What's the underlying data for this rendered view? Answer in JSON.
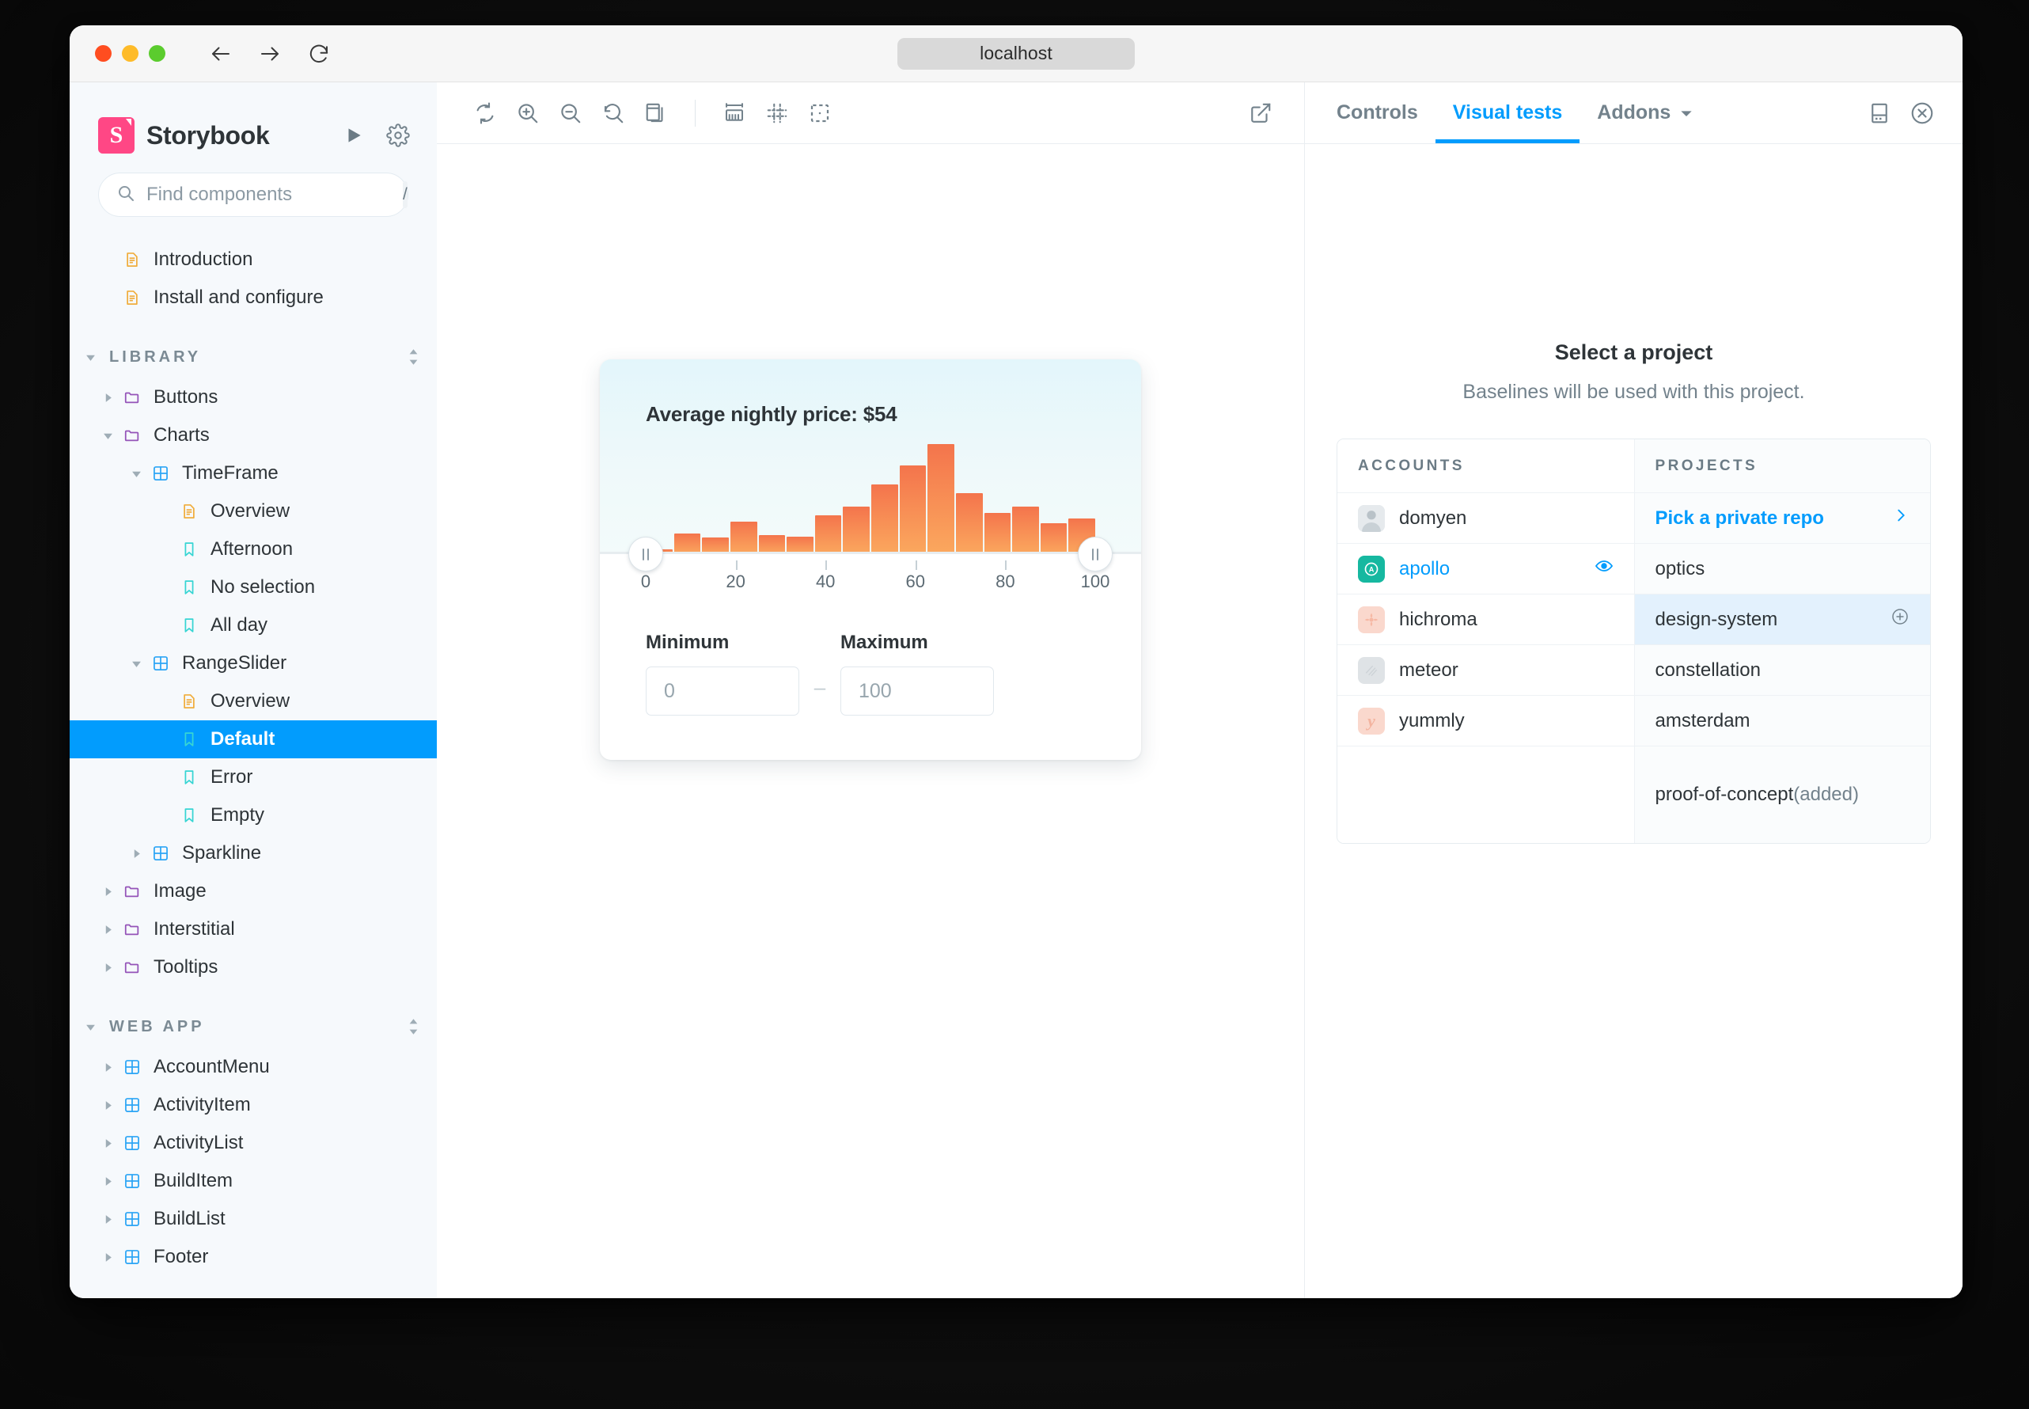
{
  "browser": {
    "url": "localhost",
    "back_icon": "arrow-left-icon",
    "forward_icon": "arrow-right-icon",
    "reload_icon": "reload-icon",
    "traffic_lights": [
      "close",
      "minimize",
      "maximize"
    ]
  },
  "sidebar": {
    "brand": "Storybook",
    "logo_letter": "S",
    "brand_color": "#ff4785",
    "play_icon": "play-icon",
    "settings_icon": "gear-icon",
    "search": {
      "placeholder": "Find components",
      "value": "",
      "shortcut": "/",
      "icon": "search-icon"
    },
    "top_items": [
      {
        "label": "Introduction",
        "icon": "document-icon"
      },
      {
        "label": "Install and configure",
        "icon": "document-icon"
      }
    ],
    "sections": [
      {
        "title": "LIBRARY",
        "items": [
          {
            "label": "Buttons",
            "icon": "folder-icon",
            "depth": 0,
            "expanded": false,
            "caret": true
          },
          {
            "label": "Charts",
            "icon": "folder-icon",
            "depth": 0,
            "expanded": true,
            "caret": true
          },
          {
            "label": "TimeFrame",
            "icon": "component-icon",
            "depth": 1,
            "expanded": true,
            "caret": true
          },
          {
            "label": "Overview",
            "icon": "document-icon",
            "depth": 2,
            "caret": false
          },
          {
            "label": "Afternoon",
            "icon": "story-icon",
            "depth": 2,
            "caret": false
          },
          {
            "label": "No selection",
            "icon": "story-icon",
            "depth": 2,
            "caret": false
          },
          {
            "label": "All day",
            "icon": "story-icon",
            "depth": 2,
            "caret": false
          },
          {
            "label": "RangeSlider",
            "icon": "component-icon",
            "depth": 1,
            "expanded": true,
            "caret": true
          },
          {
            "label": "Overview",
            "icon": "document-icon",
            "depth": 2,
            "caret": false
          },
          {
            "label": "Default",
            "icon": "story-icon",
            "depth": 2,
            "caret": false,
            "selected": true
          },
          {
            "label": "Error",
            "icon": "story-icon",
            "depth": 2,
            "caret": false
          },
          {
            "label": "Empty",
            "icon": "story-icon",
            "depth": 2,
            "caret": false
          },
          {
            "label": "Sparkline",
            "icon": "component-icon",
            "depth": 1,
            "expanded": false,
            "caret": true
          },
          {
            "label": "Image",
            "icon": "folder-icon",
            "depth": 0,
            "expanded": false,
            "caret": true
          },
          {
            "label": "Interstitial",
            "icon": "folder-icon",
            "depth": 0,
            "expanded": false,
            "caret": true
          },
          {
            "label": "Tooltips",
            "icon": "folder-icon",
            "depth": 0,
            "expanded": false,
            "caret": true
          }
        ]
      },
      {
        "title": "WEB APP",
        "items": [
          {
            "label": "AccountMenu",
            "icon": "component-icon",
            "depth": 0,
            "expanded": false,
            "caret": true
          },
          {
            "label": "ActivityItem",
            "icon": "component-icon",
            "depth": 0,
            "expanded": false,
            "caret": true
          },
          {
            "label": "ActivityList",
            "icon": "component-icon",
            "depth": 0,
            "expanded": false,
            "caret": true
          },
          {
            "label": "BuildItem",
            "icon": "component-icon",
            "depth": 0,
            "expanded": false,
            "caret": true
          },
          {
            "label": "BuildList",
            "icon": "component-icon",
            "depth": 0,
            "expanded": false,
            "caret": true
          },
          {
            "label": "Footer",
            "icon": "component-icon",
            "depth": 0,
            "expanded": false,
            "caret": true
          }
        ]
      }
    ]
  },
  "canvas_toolbar": {
    "buttons": [
      {
        "name": "remount-icon",
        "title": "Remount component"
      },
      {
        "name": "zoom-in-icon",
        "title": "Zoom in"
      },
      {
        "name": "zoom-out-icon",
        "title": "Zoom out"
      },
      {
        "name": "zoom-reset-icon",
        "title": "Reset zoom"
      },
      {
        "name": "background-icon",
        "title": "Change background"
      },
      {
        "name": "measure-icon",
        "title": "Measure"
      },
      {
        "name": "grid-icon",
        "title": "Grid"
      },
      {
        "name": "outline-icon",
        "title": "Outline"
      }
    ],
    "open_new_tab_icon": "external-link-icon"
  },
  "story": {
    "title": "Average nightly price: $54",
    "minimum_label": "Minimum",
    "maximum_label": "Maximum",
    "minimum_value": "0",
    "maximum_value": "100",
    "separator": "–",
    "handle_left_icon": "slider-handle-icon",
    "handle_right_icon": "slider-handle-icon"
  },
  "chart_data": {
    "type": "bar",
    "title": "Average nightly price: $54",
    "xlabel": "",
    "ylabel": "",
    "grid": false,
    "legend": null,
    "xlim": [
      0,
      100
    ],
    "tick_labels": [
      "0",
      "20",
      "40",
      "60",
      "80",
      "100"
    ],
    "tick_values": [
      0,
      20,
      40,
      60,
      80,
      100
    ],
    "bin_width": 5.5,
    "categories": [
      "0-6",
      "6-11",
      "11-17",
      "17-22",
      "22-28",
      "28-33",
      "33-39",
      "39-44",
      "44-50",
      "50-55",
      "55-61",
      "61-66",
      "66-72",
      "72-78",
      "78-83",
      "83-89",
      "89-94",
      "94-100"
    ],
    "values": [
      3,
      14,
      11,
      22,
      13,
      12,
      26,
      32,
      47,
      60,
      74,
      41,
      28,
      32,
      21,
      24
    ],
    "ymax": 80,
    "bar_color_top": "#f4744c",
    "bar_color_bottom": "#fba85e",
    "selection": {
      "min": 0,
      "max": 100
    }
  },
  "panel": {
    "tabs": [
      {
        "label": "Controls",
        "active": false
      },
      {
        "label": "Visual tests",
        "active": true
      },
      {
        "label": "Addons",
        "active": false,
        "has_chevron": true
      }
    ],
    "layout_icon": "panel-position-icon",
    "close_icon": "close-circle-icon",
    "visual_tests": {
      "heading": "Select a project",
      "subheading": "Baselines will be used with this project.",
      "columns": [
        "ACCOUNTS",
        "PROJECTS"
      ],
      "accounts": [
        {
          "name": "domyen",
          "avatar": "photo-avatar",
          "color": "#d7dde2",
          "active": false
        },
        {
          "name": "apollo",
          "avatar": "apollo-logo",
          "color": "#16b8a0",
          "active": true,
          "right_icon": "eye-icon"
        },
        {
          "name": "hichroma",
          "avatar": "hichroma-logo",
          "color": "#fad8cd",
          "active": false
        },
        {
          "name": "meteor",
          "avatar": "meteor-logo",
          "color": "#dfe3e6",
          "active": false
        },
        {
          "name": "yummly",
          "avatar": "yummly-logo",
          "color": "#fad8cd",
          "active": false
        }
      ],
      "projects": [
        {
          "name": "Pick a private repo",
          "is_link": true,
          "right_icon": "chevron-right-icon"
        },
        {
          "name": "optics"
        },
        {
          "name": "design-system",
          "highlighted": true,
          "right_icon": "plus-circle-icon"
        },
        {
          "name": "constellation"
        },
        {
          "name": "amsterdam"
        },
        {
          "name": "proof-of-concept",
          "suffix": " (added)"
        }
      ]
    }
  }
}
